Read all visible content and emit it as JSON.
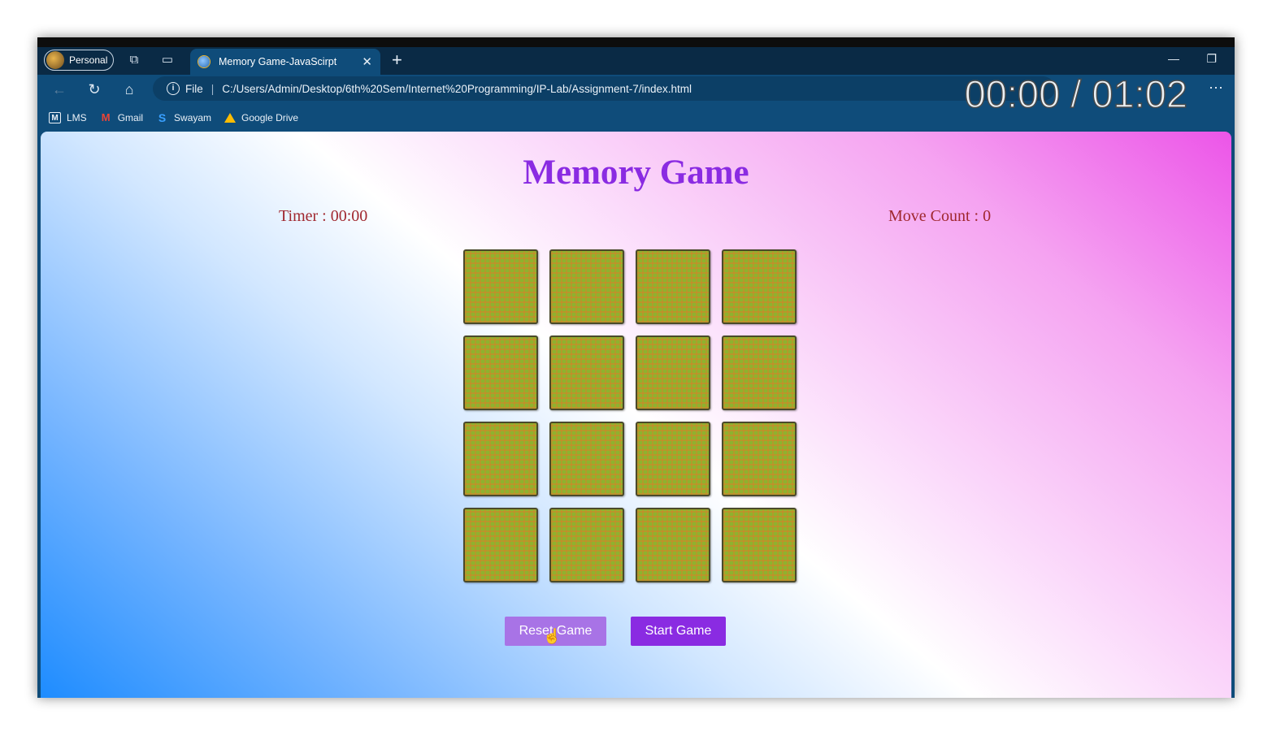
{
  "browser": {
    "profile_label": "Personal",
    "tab_title": "Memory Game-JavaScirpt",
    "address_scheme_label": "File",
    "address_url": "C:/Users/Admin/Desktop/6th%20Sem/Internet%20Programming/IP-Lab/Assignment-7/index.html",
    "video_timestamp": "00:00 / 01:02",
    "bookmarks": [
      {
        "label": "LMS",
        "icon": "lms-icon"
      },
      {
        "label": "Gmail",
        "icon": "gmail-icon"
      },
      {
        "label": "Swayam",
        "icon": "swayam-icon"
      },
      {
        "label": "Google Drive",
        "icon": "google-drive-icon"
      }
    ]
  },
  "game": {
    "title": "Memory Game",
    "timer_label": "Timer : 00:00",
    "move_count_label": "Move Count : 0",
    "cards_face_down": 16,
    "reset_button": "Reset Game",
    "start_button": "Start Game"
  },
  "colors": {
    "title": "#8a2be2",
    "stats_text": "#a0282f",
    "reset_button": "#a873e6",
    "start_button": "#8a2be2",
    "card_back": "#8fb22e"
  }
}
